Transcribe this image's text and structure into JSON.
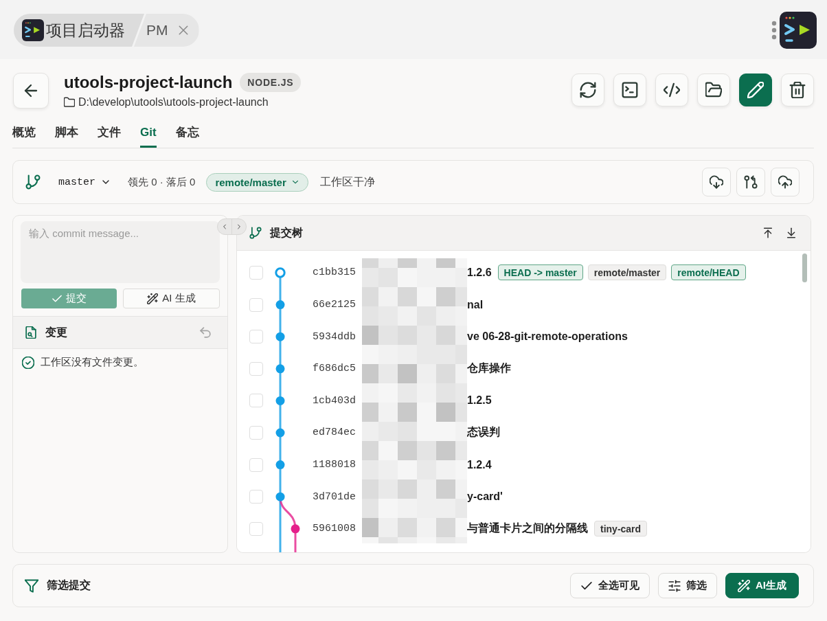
{
  "title_bar": {
    "app_name": "项目启动器",
    "tab": "PM"
  },
  "project": {
    "name": "utools-project-launch",
    "badge": "NODE.JS",
    "path": "D:\\develop\\utools\\utools-project-launch"
  },
  "actions": [
    {
      "kind": "refresh",
      "primary": false
    },
    {
      "kind": "terminal",
      "primary": false
    },
    {
      "kind": "code",
      "primary": false
    },
    {
      "kind": "folder",
      "primary": false
    },
    {
      "kind": "edit",
      "primary": true
    },
    {
      "kind": "delete",
      "primary": false
    }
  ],
  "tabs": [
    {
      "label": "概览",
      "selected": false
    },
    {
      "label": "脚本",
      "selected": false
    },
    {
      "label": "文件",
      "selected": false
    },
    {
      "label": "Git",
      "selected": true
    },
    {
      "label": "备忘",
      "selected": false
    }
  ],
  "git_status": {
    "branch": "master",
    "ahead_behind": "领先 0 · 落后 0",
    "upstream": "remote/master",
    "worktree": "工作区干净"
  },
  "commit_panel": {
    "message_field": {
      "placeholder": "输入 commit message..."
    },
    "commit_button": {
      "label": "提交",
      "disabled": true
    },
    "ai_button": {
      "label": "AI 生成"
    },
    "changes": {
      "title": "变更",
      "empty_text": "工作区没有文件变更。"
    }
  },
  "commit_tree": {
    "title": "提交树",
    "commits": [
      {
        "hash": "c1bb315",
        "message": "1.2.6",
        "checked": false,
        "current": true,
        "kind": "main",
        "color": "#139fe6",
        "refs": [
          {
            "label": "HEAD -> master",
            "highlighted": true
          },
          {
            "label": "remote/master",
            "highlighted": false
          },
          {
            "label": "remote/HEAD",
            "highlighted": true
          }
        ]
      },
      {
        "hash": "66e2125",
        "message": "nal",
        "checked": false,
        "current": false,
        "kind": "main",
        "color": "#139fe6"
      },
      {
        "hash": "5934ddb",
        "message": "ve 06-28-git-remote-operations",
        "checked": false,
        "current": false,
        "kind": "main",
        "color": "#139fe6"
      },
      {
        "hash": "f686dc5",
        "message": "仓库操作",
        "checked": false,
        "current": false,
        "kind": "main",
        "color": "#139fe6"
      },
      {
        "hash": "1cb403d",
        "message": "1.2.5",
        "checked": false,
        "current": false,
        "kind": "main",
        "color": "#139fe6"
      },
      {
        "hash": "ed784ec",
        "message": "态误判",
        "checked": false,
        "current": false,
        "kind": "main",
        "color": "#139fe6"
      },
      {
        "hash": "1188018",
        "message": "1.2.4",
        "checked": false,
        "current": false,
        "kind": "main",
        "color": "#139fe6"
      },
      {
        "hash": "3d701de",
        "message": "y-card'",
        "checked": false,
        "current": false,
        "kind": "main",
        "color": "#139fe6"
      },
      {
        "hash": "5961008",
        "message": "与普通卡片之间的分隔线",
        "checked": false,
        "current": false,
        "kind": "side",
        "color": "#e5208b",
        "refs": [
          {
            "label": "tiny-card",
            "highlighted": false
          }
        ]
      }
    ]
  },
  "filter_bar": {
    "title": "筛选提交",
    "buttons": [
      {
        "label": "全选可见",
        "kind": "select_all",
        "primary": false
      },
      {
        "label": "筛选",
        "kind": "filter",
        "primary": false
      },
      {
        "label": "AI生成",
        "kind": "ai",
        "primary": true
      }
    ]
  }
}
